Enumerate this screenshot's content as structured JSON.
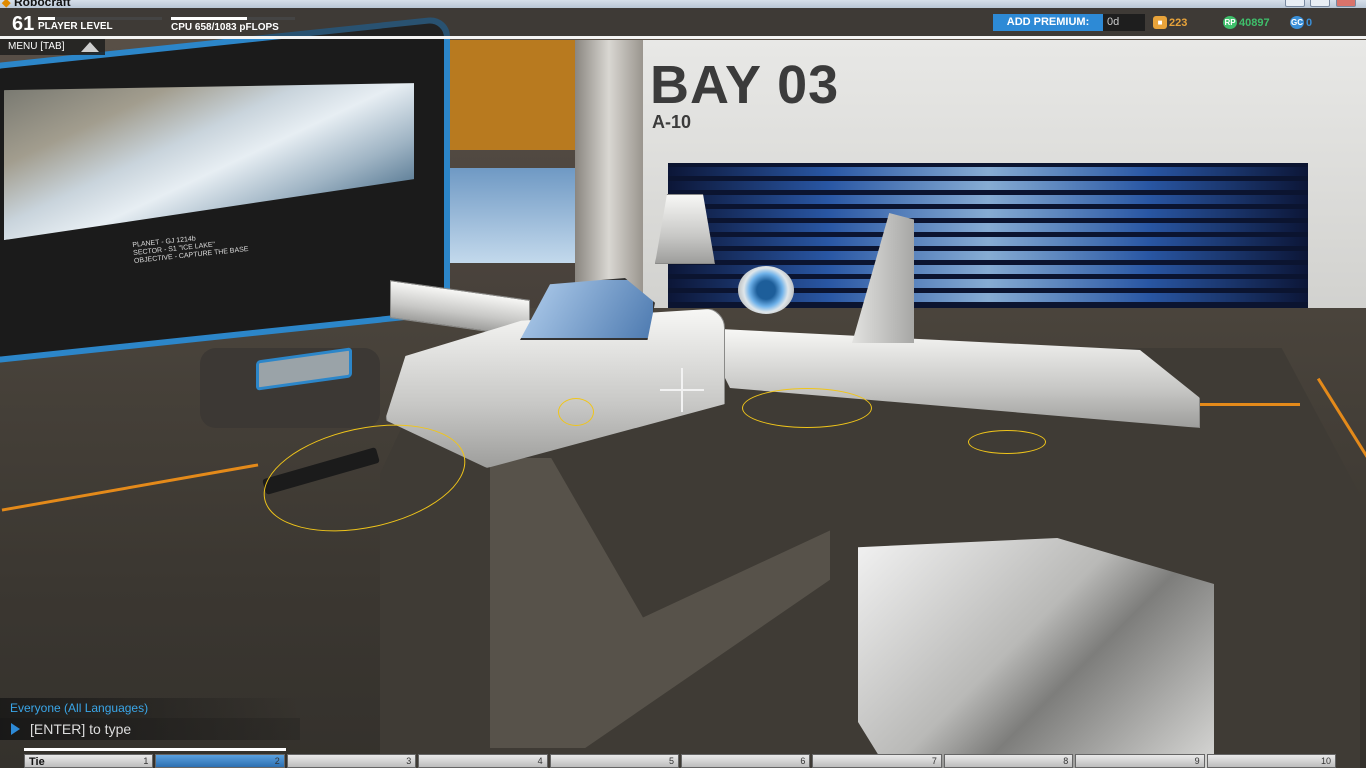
{
  "window": {
    "title": "Robocraft"
  },
  "hud": {
    "player_level": "61",
    "player_level_label": "PLAYER LEVEL",
    "cpu": "CPU 658/1083 pFLOPS",
    "add_premium_label": "ADD PREMIUM:",
    "premium_days": "0d",
    "currency_crates": "223",
    "currency_rp": "40897",
    "currency_gc": "0"
  },
  "menu": {
    "label": "MENU [TAB]"
  },
  "bay": {
    "title": "BAY 03",
    "subtitle": "A-10"
  },
  "mission": {
    "planet": "PLANET - GJ 1214b",
    "sector": "SECTOR - S1 \"ICE LAKE\"",
    "objective": "OBJECTIVE - CAPTURE THE BASE"
  },
  "chat": {
    "channel": "Everyone (All Languages)",
    "input_placeholder": "[ENTER] to type"
  },
  "hotbar": {
    "slots": [
      {
        "num": "1",
        "name": "Tie"
      },
      {
        "num": "2",
        "name": ""
      },
      {
        "num": "3",
        "name": ""
      },
      {
        "num": "4",
        "name": ""
      },
      {
        "num": "5",
        "name": ""
      },
      {
        "num": "6",
        "name": ""
      },
      {
        "num": "7",
        "name": ""
      },
      {
        "num": "8",
        "name": ""
      },
      {
        "num": "9",
        "name": ""
      },
      {
        "num": "10",
        "name": ""
      }
    ]
  },
  "icons": [
    "robocraft-logo-icon",
    "crate-icon",
    "rp-icon",
    "gc-icon",
    "menu-arrow-icon",
    "chat-arrow-icon",
    "crosshair-icon"
  ],
  "colors": {
    "accent_blue": "#2d8ad6",
    "accent_orange": "#e48a1a",
    "rp_green": "#3fbf6b",
    "crate_orange": "#e8a33a",
    "gc_blue": "#3a8fd8"
  }
}
